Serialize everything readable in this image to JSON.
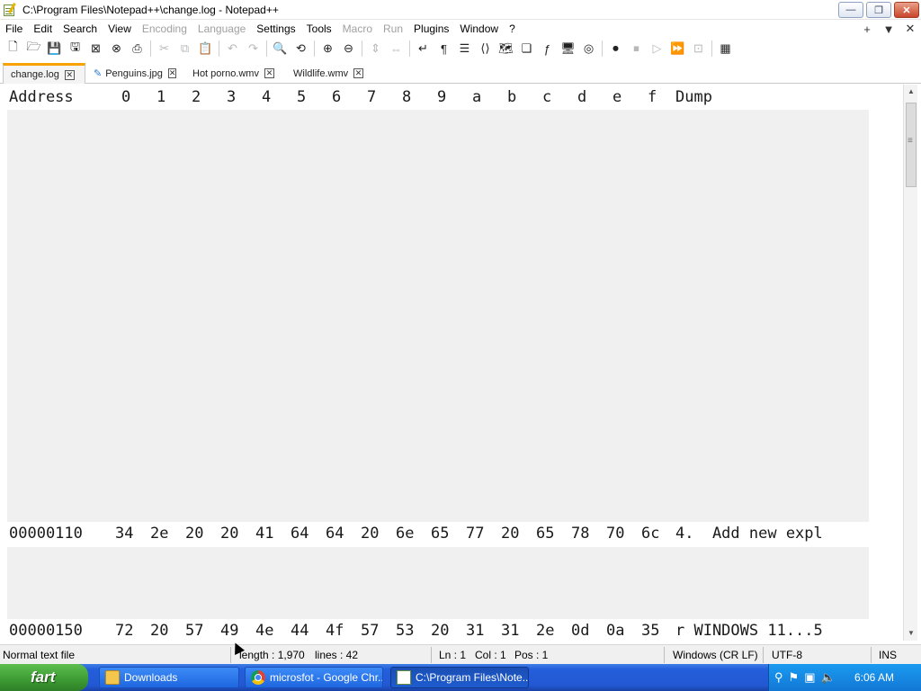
{
  "window": {
    "title": "C:\\Program Files\\Notepad++\\change.log - Notepad++",
    "minimize": "—",
    "restore": "❐",
    "close": "✕"
  },
  "menu": {
    "items": [
      "File",
      "Edit",
      "Search",
      "View",
      "Encoding",
      "Language",
      "Settings",
      "Tools",
      "Macro",
      "Run",
      "Plugins",
      "Window",
      "?"
    ],
    "disabled": [
      "Encoding",
      "Language",
      "Macro",
      "Run"
    ],
    "right": [
      "+",
      "▼",
      "✕"
    ]
  },
  "tabs": [
    {
      "label": "change.log",
      "close": "✕",
      "active": true
    },
    {
      "label": "Penguins.jpg",
      "close": "✕",
      "active": false,
      "modified": true
    },
    {
      "label": "Hot porno.wmv",
      "close": "✕",
      "active": false
    },
    {
      "label": "Wildlife.wmv",
      "close": "✕",
      "active": false
    }
  ],
  "hex": {
    "header": {
      "address": "Address",
      "columns": [
        "0",
        "1",
        "2",
        "3",
        "4",
        "5",
        "6",
        "7",
        "8",
        "9",
        "a",
        "b",
        "c",
        "d",
        "e",
        "f"
      ],
      "dump": "Dump"
    },
    "rows": [
      {
        "address": "00000110",
        "bytes": [
          "34",
          "2e",
          "20",
          "20",
          "41",
          "64",
          "64",
          "20",
          "6e",
          "65",
          "77",
          "20",
          "65",
          "78",
          "70",
          "6c"
        ],
        "dump": "4.  Add new expl"
      },
      {
        "address": "00000150",
        "bytes": [
          "72",
          "20",
          "57",
          "49",
          "4e",
          "44",
          "4f",
          "57",
          "53",
          "20",
          "31",
          "31",
          "2e",
          "0d",
          "0a",
          "35"
        ],
        "dump": "r WINDOWS 11...5"
      }
    ]
  },
  "status": {
    "file_type": "Normal text file",
    "length": "length : 1,970",
    "lines": "lines : 42",
    "ln": "Ln : 1",
    "col": "Col : 1",
    "pos": "Pos : 1",
    "eol": "Windows (CR LF)",
    "encoding": "UTF-8",
    "mode": "INS"
  },
  "taskbar": {
    "start": "fart",
    "buttons": [
      {
        "label": "Downloads"
      },
      {
        "label": "microsfot - Google Chr..."
      },
      {
        "label": "C:\\Program Files\\Note..."
      }
    ],
    "time": "6:06 AM"
  },
  "colors": {
    "active_tab_accent": "#f7a200",
    "taskbar_blue": "#245edb",
    "start_green": "#3c9a33",
    "hex_gap": "#f0f0f0"
  }
}
